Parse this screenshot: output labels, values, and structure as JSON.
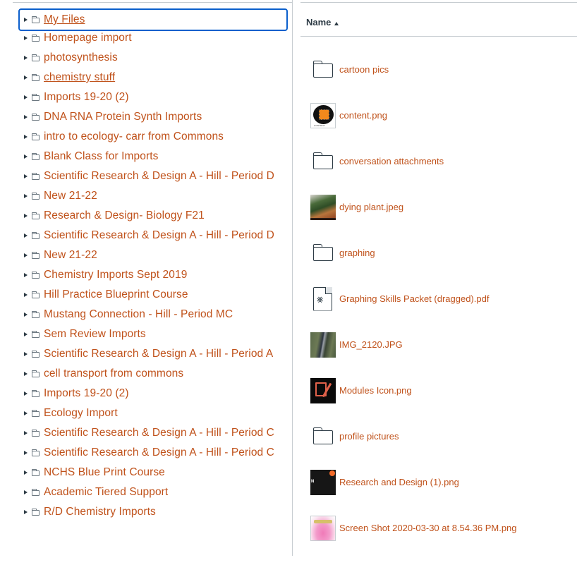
{
  "folder_tree": {
    "items": [
      {
        "label": "My Files",
        "focused": true,
        "underlined": true
      },
      {
        "label": "Homepage import"
      },
      {
        "label": "photosynthesis"
      },
      {
        "label": "chemistry stuff",
        "underlined": true
      },
      {
        "label": "Imports 19-20 (2)"
      },
      {
        "label": "DNA RNA Protein Synth Imports"
      },
      {
        "label": "intro to ecology- carr from Commons"
      },
      {
        "label": "Blank Class for Imports"
      },
      {
        "label": "Scientific Research & Design A - Hill - Period D"
      },
      {
        "label": "New 21-22"
      },
      {
        "label": "Research & Design- Biology F21"
      },
      {
        "label": "Scientific Research & Design A - Hill - Period D"
      },
      {
        "label": "New 21-22"
      },
      {
        "label": "Chemistry Imports Sept 2019"
      },
      {
        "label": "Hill Practice Blueprint Course"
      },
      {
        "label": "Mustang Connection - Hill - Period MC"
      },
      {
        "label": "Sem Review Imports"
      },
      {
        "label": "Scientific Research & Design A - Hill - Period A"
      },
      {
        "label": "cell transport from commons"
      },
      {
        "label": "Imports 19-20 (2)"
      },
      {
        "label": "Ecology Import"
      },
      {
        "label": "Scientific Research & Design A - Hill - Period C"
      },
      {
        "label": "Scientific Research & Design A - Hill - Period C"
      },
      {
        "label": "NCHS Blue Print Course"
      },
      {
        "label": "Academic Tiered Support"
      },
      {
        "label": "R/D Chemistry Imports"
      }
    ]
  },
  "file_list": {
    "column_header": "Name",
    "sort_direction": "ascending",
    "items": [
      {
        "name": "cartoon pics",
        "type": "folder",
        "icon": "folder-icon"
      },
      {
        "name": "content.png",
        "type": "image",
        "icon": "content-thumbnail",
        "thumb_caption": "CONTENT"
      },
      {
        "name": "conversation attachments",
        "type": "folder",
        "icon": "folder-icon"
      },
      {
        "name": "dying plant.jpeg",
        "type": "image",
        "icon": "plant-thumbnail"
      },
      {
        "name": "graphing",
        "type": "folder",
        "icon": "folder-icon"
      },
      {
        "name": "Graphing Skills Packet (dragged).pdf",
        "type": "pdf",
        "icon": "pdf-icon"
      },
      {
        "name": "IMG_2120.JPG",
        "type": "image",
        "icon": "photo-thumbnail"
      },
      {
        "name": "Modules Icon.png",
        "type": "image",
        "icon": "modules-thumbnail"
      },
      {
        "name": "profile pictures",
        "type": "folder",
        "icon": "folder-icon"
      },
      {
        "name": "Research and Design (1).png",
        "type": "image",
        "icon": "research-thumbnail",
        "thumb_letter": "N"
      },
      {
        "name": "Screen Shot 2020-03-30 at 8.54.36 PM.png",
        "type": "image",
        "icon": "screenshot-thumbnail"
      }
    ]
  },
  "colors": {
    "link": "#c0521b",
    "focus_ring": "#0b5fcc",
    "text_dark": "#2d3b45",
    "divider": "#c7cdd1"
  }
}
